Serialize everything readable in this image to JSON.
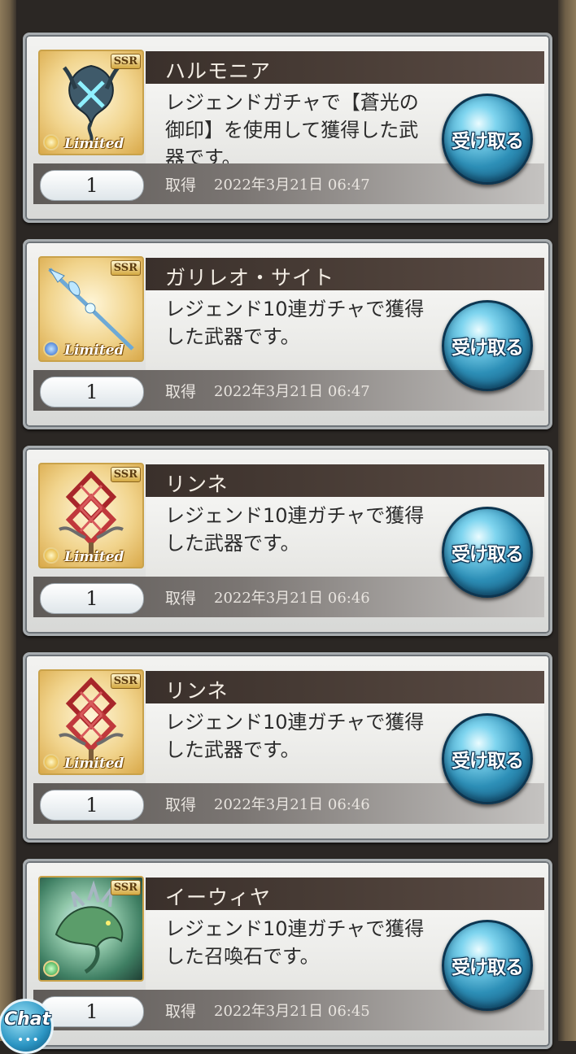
{
  "common": {
    "limited_label": "Limited",
    "rarity_label": "SSR",
    "acquired_label": "取得",
    "receive_label": "受け取る"
  },
  "items": [
    {
      "name": "ハルモニア",
      "description": "レジェンドガチャで【蒼光の御印】を使用して獲得した武器です。",
      "count": "1",
      "date": "2022年3月21日 06:47",
      "element_icon": "light-element-icon"
    },
    {
      "name": "ガリレオ・サイト",
      "description": "レジェンド10連ガチャで獲得した武器です。",
      "count": "1",
      "date": "2022年3月21日 06:47",
      "element_icon": "water-element-icon"
    },
    {
      "name": "リンネ",
      "description": "レジェンド10連ガチャで獲得した武器です。",
      "count": "1",
      "date": "2022年3月21日 06:46",
      "element_icon": "light-element-icon"
    },
    {
      "name": "リンネ",
      "description": "レジェンド10連ガチャで獲得した武器です。",
      "count": "1",
      "date": "2022年3月21日 06:46",
      "element_icon": "light-element-icon"
    },
    {
      "name": "イーウィヤ",
      "description": "レジェンド10連ガチャで獲得した召喚石です。",
      "count": "1",
      "date": "2022年3月21日 06:45",
      "element_icon": "wind-element-icon"
    }
  ],
  "chat": {
    "label": "Chat",
    "dots": "•••"
  }
}
